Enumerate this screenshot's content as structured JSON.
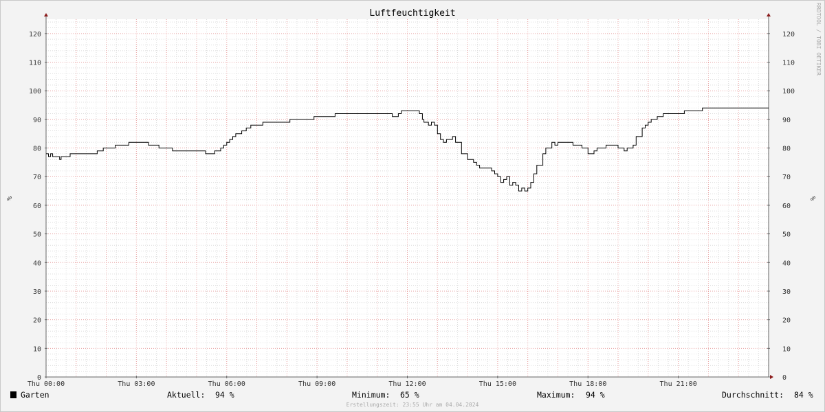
{
  "chart_data": {
    "type": "line",
    "title": "Luftfeuchtigkeit",
    "ylabel": "%",
    "ylim": [
      0,
      125
    ],
    "y_ticks": [
      0,
      10,
      20,
      30,
      40,
      50,
      60,
      70,
      80,
      90,
      100,
      110,
      120
    ],
    "xlim": [
      0,
      24
    ],
    "x_ticks": [
      {
        "hour": 0,
        "label": "Thu 00:00"
      },
      {
        "hour": 3,
        "label": "Thu 03:00"
      },
      {
        "hour": 6,
        "label": "Thu 06:00"
      },
      {
        "hour": 9,
        "label": "Thu 09:00"
      },
      {
        "hour": 12,
        "label": "Thu 12:00"
      },
      {
        "hour": 15,
        "label": "Thu 15:00"
      },
      {
        "hour": 18,
        "label": "Thu 18:00"
      },
      {
        "hour": 21,
        "label": "Thu 21:00"
      }
    ],
    "grid": true,
    "series": [
      {
        "name": "Garten",
        "color": "#000000",
        "step": true,
        "x": [
          0.0,
          0.08,
          0.15,
          0.22,
          0.3,
          0.45,
          0.5,
          0.6,
          0.8,
          1.0,
          1.2,
          1.7,
          1.9,
          2.3,
          2.75,
          3.4,
          3.75,
          4.2,
          4.5,
          5.3,
          5.5,
          5.6,
          5.8,
          5.9,
          6.0,
          6.1,
          6.2,
          6.3,
          6.5,
          6.65,
          6.8,
          7.0,
          7.2,
          7.75,
          7.9,
          8.1,
          8.3,
          8.9,
          9.0,
          9.6,
          9.7,
          10.0,
          10.3,
          11.5,
          11.6,
          11.7,
          11.8,
          12.1,
          12.2,
          12.3,
          12.4,
          12.5,
          12.55,
          12.7,
          12.8,
          12.9,
          13.0,
          13.1,
          13.2,
          13.3,
          13.5,
          13.6,
          13.8,
          14.0,
          14.2,
          14.3,
          14.4,
          14.5,
          14.6,
          14.7,
          14.8,
          14.9,
          15.0,
          15.1,
          15.2,
          15.3,
          15.4,
          15.5,
          15.6,
          15.7,
          15.8,
          15.9,
          16.0,
          16.1,
          16.2,
          16.3,
          16.5,
          16.6,
          16.8,
          16.9,
          17.0,
          17.1,
          17.5,
          17.6,
          17.8,
          18.0,
          18.2,
          18.3,
          18.5,
          18.6,
          18.8,
          19.0,
          19.2,
          19.3,
          19.5,
          19.6,
          19.8,
          19.9,
          20.0,
          20.1,
          20.3,
          20.5,
          20.6,
          21.2,
          21.4,
          21.8,
          22.2,
          24.0
        ],
        "values": [
          78,
          77,
          78,
          77,
          77,
          76,
          77,
          77,
          78,
          78,
          78,
          79,
          80,
          81,
          82,
          81,
          80,
          79,
          79,
          78,
          78,
          79,
          80,
          81,
          82,
          83,
          84,
          85,
          86,
          87,
          88,
          88,
          89,
          89,
          89,
          90,
          90,
          91,
          91,
          92,
          92,
          92,
          92,
          91,
          91,
          92,
          93,
          93,
          93,
          93,
          92,
          90,
          89,
          88,
          89,
          88,
          85,
          83,
          82,
          83,
          84,
          82,
          78,
          76,
          75,
          74,
          73,
          73,
          73,
          73,
          72,
          71,
          70,
          68,
          69,
          70,
          67,
          68,
          67,
          65,
          66,
          65,
          66,
          68,
          71,
          74,
          78,
          80,
          82,
          81,
          82,
          82,
          81,
          81,
          80,
          78,
          79,
          80,
          80,
          81,
          81,
          80,
          79,
          80,
          81,
          84,
          87,
          88,
          89,
          90,
          91,
          92,
          92,
          93,
          93,
          94,
          94,
          94
        ]
      }
    ],
    "legend": {
      "marker_color": "#000000",
      "series_name": "Garten",
      "stats": [
        {
          "label": "Aktuell:",
          "value": "94 %"
        },
        {
          "label": "Minimum:",
          "value": "65 %"
        },
        {
          "label": "Maximum:",
          "value": "94 %"
        },
        {
          "label": "Durchschnitt:",
          "value": "84 %"
        }
      ]
    },
    "watermark": "RRDTOOL / TOBI OETIKER",
    "footer": "Erstellungszeit: 23:55 Uhr am 04.04.2024"
  }
}
